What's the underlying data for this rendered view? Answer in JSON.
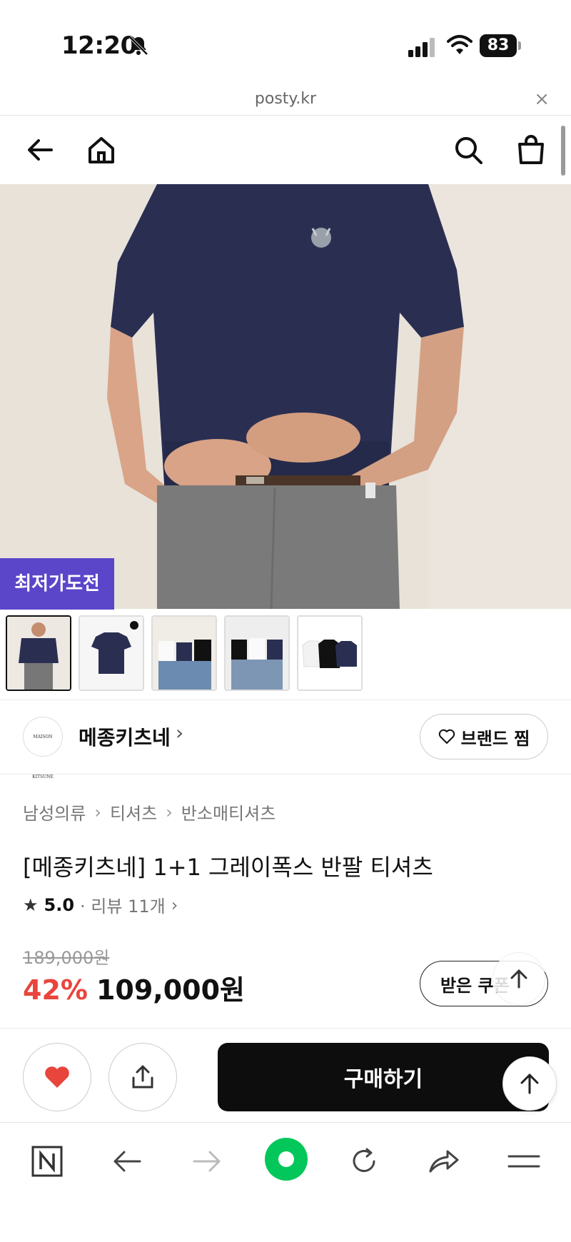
{
  "status_bar": {
    "time": "12:20",
    "battery": "83"
  },
  "url_bar": {
    "domain": "posty.kr",
    "close": "×"
  },
  "header": {},
  "hero": {
    "badge": "최저가도전"
  },
  "brand": {
    "logo_text": "MAISON KITSUNÉ",
    "name": "메종키츠네",
    "chevron": "›",
    "favorite_label": "브랜드 찜"
  },
  "breadcrumb": [
    "남성의류",
    "티셔츠",
    "반소매티셔츠"
  ],
  "product": {
    "title": "[메종키츠네] 1+1 그레이폭스 반팔 티셔츠",
    "rating": "5.0",
    "review_label": "· 리뷰 11개",
    "price_original": "189,000원",
    "discount": "42%",
    "price_final": "109,000원",
    "coupon_label": "받은 쿠폰"
  },
  "actions": {
    "buy_label": "구매하기"
  },
  "colors": {
    "badge": "#5b45c9",
    "discount": "#e8453c",
    "heart": "#e8453c",
    "naver_green": "#03c75a"
  }
}
